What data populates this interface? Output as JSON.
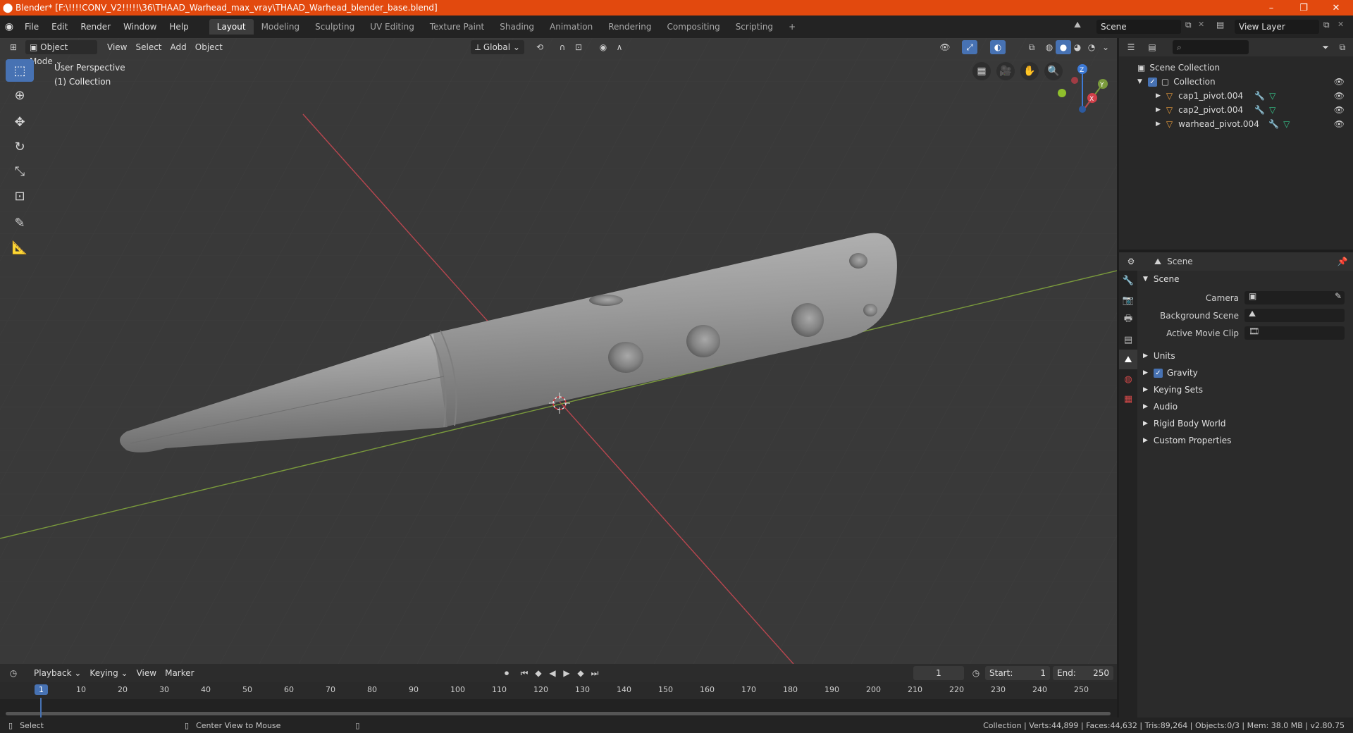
{
  "window": {
    "title": "Blender* [F:\\!!!!CONV_V2!!!!!\\36\\THAAD_Warhead_max_vray\\THAAD_Warhead_blender_base.blend]",
    "minimize": "–",
    "restore": "❐",
    "close": "✕"
  },
  "menus": [
    "File",
    "Edit",
    "Render",
    "Window",
    "Help"
  ],
  "workspaces": [
    "Layout",
    "Modeling",
    "Sculpting",
    "UV Editing",
    "Texture Paint",
    "Shading",
    "Animation",
    "Rendering",
    "Compositing",
    "Scripting"
  ],
  "active_workspace": "Layout",
  "scene_field": "Scene",
  "view_layer_field": "View Layer",
  "viewport": {
    "mode": "Object Mode",
    "menus": [
      "View",
      "Select",
      "Add",
      "Object"
    ],
    "transform_orientation": "Global",
    "info_line1": "User Perspective",
    "info_line2": "(1) Collection",
    "gizmo_axes": {
      "z": "Z",
      "y": "Y",
      "x": "X"
    },
    "colors": {
      "background": "#393939",
      "x_axis": "#b8464f",
      "y_axis": "#7a9a3c",
      "z_axis": "#3d7ad6",
      "mesh": "#8f8f8f"
    }
  },
  "tools": [
    "select-box",
    "cursor",
    "move",
    "rotate",
    "scale",
    "transform",
    "annotate",
    "measure"
  ],
  "outliner": {
    "root": "Scene Collection",
    "collection": "Collection",
    "objects": [
      "cap1_pivot.004",
      "cap2_pivot.004",
      "warhead_pivot.004"
    ]
  },
  "properties": {
    "header": "Scene",
    "section": "Scene",
    "fields": [
      {
        "label": "Camera"
      },
      {
        "label": "Background Scene"
      },
      {
        "label": "Active Movie Clip"
      }
    ],
    "subsections": [
      "Units",
      "Gravity",
      "Keying Sets",
      "Audio",
      "Rigid Body World",
      "Custom Properties"
    ],
    "gravity_checked": true
  },
  "timeline": {
    "menus": [
      "Playback",
      "Keying",
      "View",
      "Marker"
    ],
    "current_frame": "1",
    "start_label": "Start:",
    "start_value": "1",
    "end_label": "End:",
    "end_value": "250",
    "ruler": [
      "1",
      "10",
      "20",
      "30",
      "40",
      "50",
      "60",
      "70",
      "80",
      "90",
      "100",
      "110",
      "120",
      "130",
      "140",
      "150",
      "160",
      "170",
      "180",
      "190",
      "200",
      "210",
      "220",
      "230",
      "240",
      "250"
    ]
  },
  "statusbar": {
    "select": "Select",
    "center": "Center View to Mouse",
    "stats": "Collection | Verts:44,899 | Faces:44,632 | Tris:89,264 | Objects:0/3 | Mem: 38.0 MB | v2.80.75"
  }
}
